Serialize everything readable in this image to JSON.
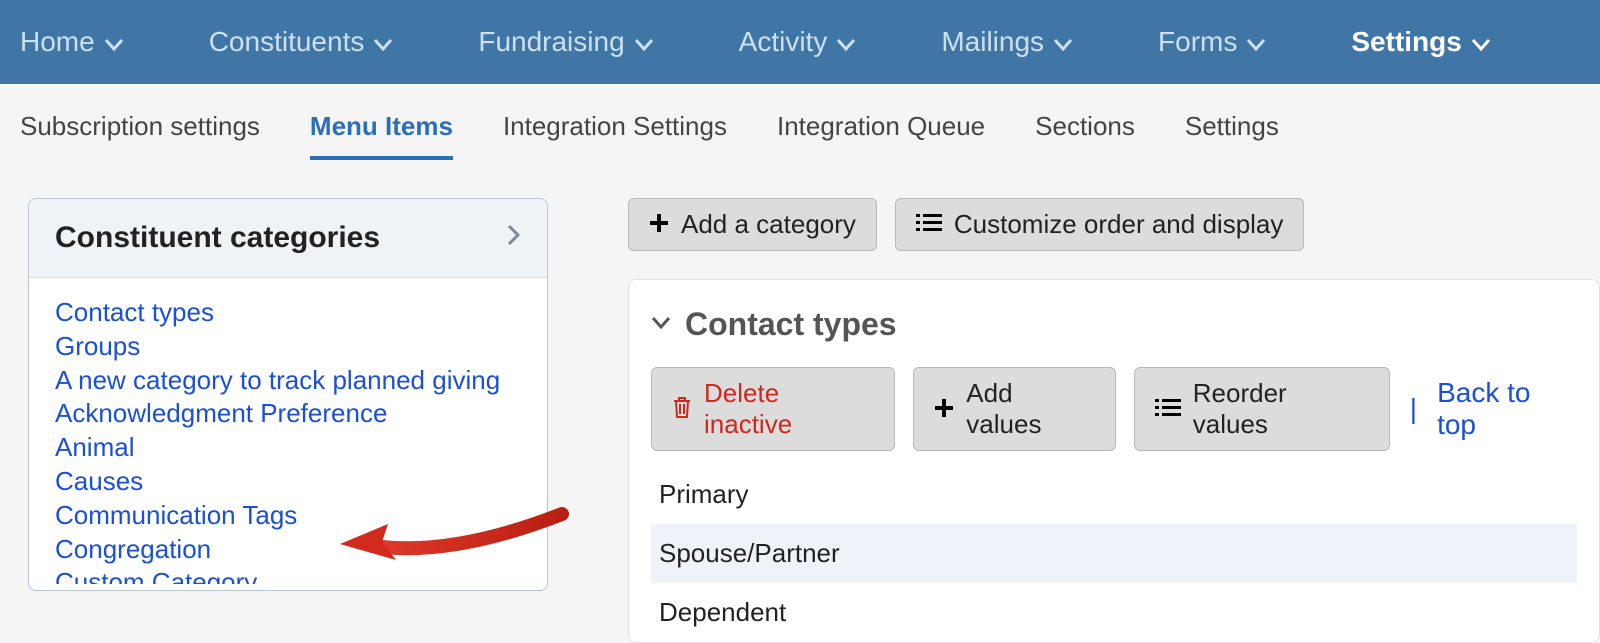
{
  "topnav": {
    "items": [
      {
        "label": "Home"
      },
      {
        "label": "Constituents"
      },
      {
        "label": "Fundraising"
      },
      {
        "label": "Activity"
      },
      {
        "label": "Mailings"
      },
      {
        "label": "Forms"
      },
      {
        "label": "Settings",
        "active": true
      }
    ]
  },
  "subtabs": {
    "items": [
      {
        "label": "Subscription settings"
      },
      {
        "label": "Menu Items",
        "active": true
      },
      {
        "label": "Integration Settings"
      },
      {
        "label": "Integration Queue"
      },
      {
        "label": "Sections"
      },
      {
        "label": "Settings"
      }
    ]
  },
  "sidebar": {
    "title": "Constituent categories",
    "categories": [
      "Contact types",
      "Groups",
      "A new category to track planned giving",
      "Acknowledgment Preference",
      "Animal",
      "Causes",
      "Communication Tags",
      "Congregation",
      "Custom Category"
    ]
  },
  "toolbar": {
    "add_category": "Add a category",
    "customize": "Customize order and display"
  },
  "section": {
    "title": "Contact types",
    "delete_inactive": "Delete inactive",
    "add_values": "Add values",
    "reorder_values": "Reorder values",
    "back_to_top": "Back to top",
    "values": [
      "Primary",
      "Spouse/Partner",
      "Dependent"
    ]
  },
  "colors": {
    "navbg": "#3f76a6",
    "link": "#1a4fd6",
    "danger": "#cc2a1f"
  }
}
